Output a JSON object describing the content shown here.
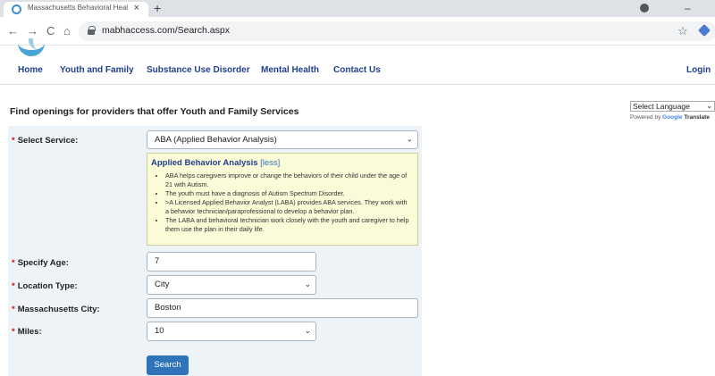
{
  "browser": {
    "tab_title": "Massachusetts Behavioral Health",
    "tab_close": "×",
    "new_tab": "+",
    "url": "mabhaccess.com/Search.aspx",
    "back": "←",
    "forward": "→",
    "reload": "C",
    "home": "⌂",
    "star": "☆",
    "minimize": "–"
  },
  "nav": {
    "items": [
      {
        "label": "Home"
      },
      {
        "label": "Youth and Family"
      },
      {
        "label": "Substance Use Disorder"
      },
      {
        "label": "Mental Health"
      },
      {
        "label": "Contact Us"
      }
    ],
    "login": "Login"
  },
  "translate": {
    "select_label": "Select Language",
    "powered_prefix": "Powered by",
    "powered_google": "Google",
    "powered_suffix": "Translate"
  },
  "page": {
    "heading": "Find openings for providers that offer Youth and Family Services"
  },
  "form": {
    "required_mark": "*",
    "service": {
      "label": "Select Service:",
      "value": "ABA (Applied Behavior Analysis)"
    },
    "info": {
      "title": "Applied Behavior Analysis",
      "toggle": "[less]",
      "bullets": [
        "ABA helps caregivers improve or change the behaviors of their child under the age of 21 with Autism.",
        "The youth must have a diagnosis of Autism Spectrum Disorder.",
        ">A Licensed Applied Behavior Analyst (LABA) provides ABA services. They work with a behavior technician/paraprofessional to develop a behavior plan.",
        "The LABA and behavioral technician work closely with the youth and caregiver to help them use the plan in their daily life."
      ]
    },
    "age": {
      "label": "Specify Age:",
      "value": "7"
    },
    "location_type": {
      "label": "Location Type:",
      "value": "City"
    },
    "city": {
      "label": "Massachusetts City:",
      "value": "Boston"
    },
    "miles": {
      "label": "Miles:",
      "value": "10"
    },
    "search_button": "Search"
  }
}
